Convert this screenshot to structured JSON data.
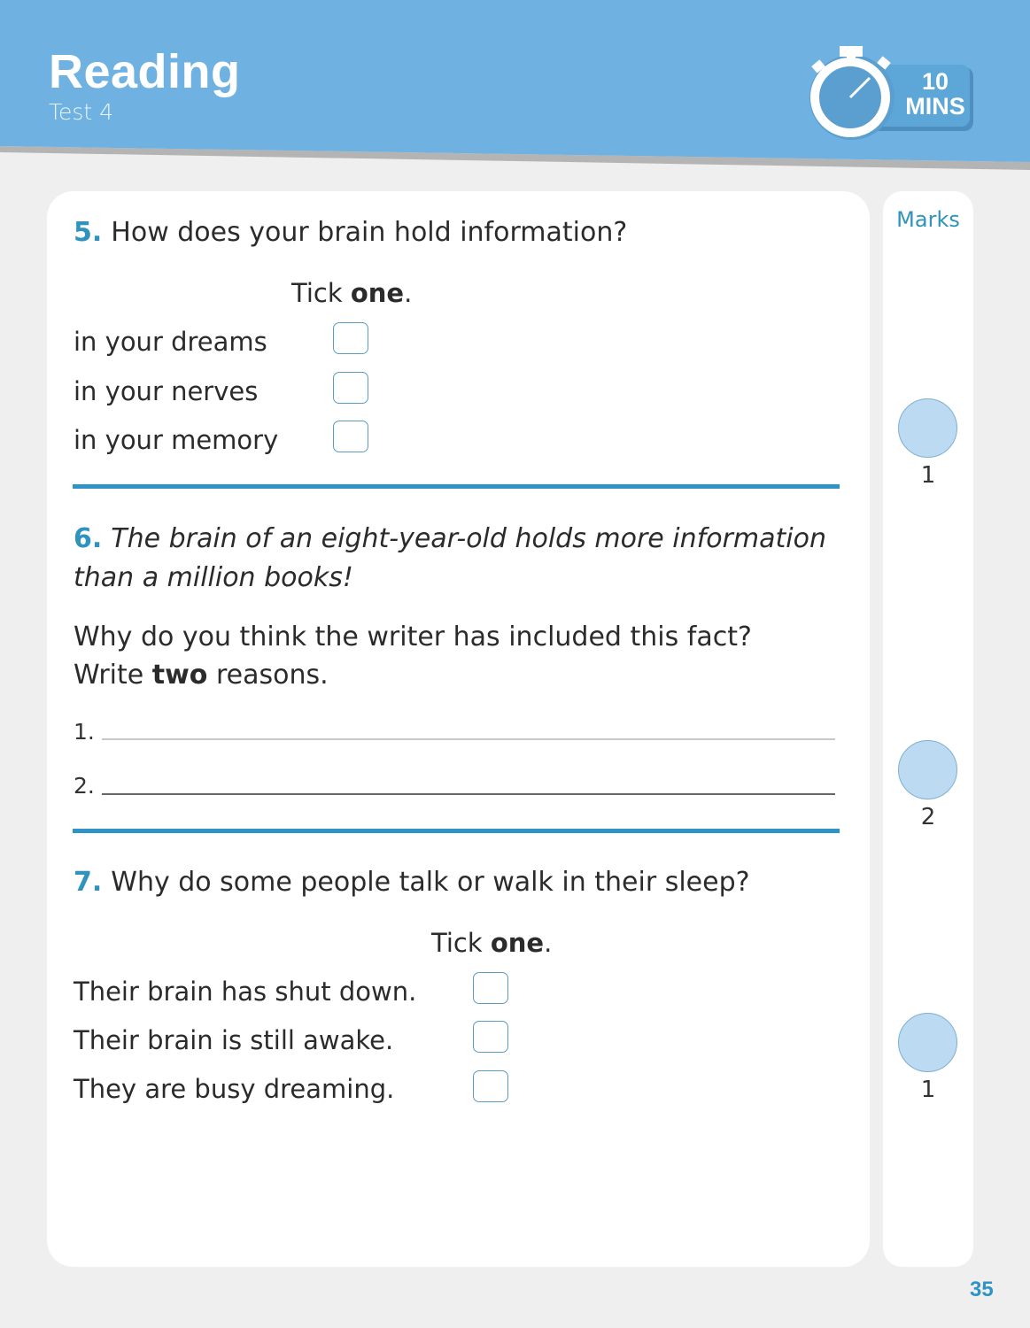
{
  "header": {
    "title": "Reading",
    "subtitle": "Test 4",
    "timer": {
      "icon": "stopwatch-icon",
      "value": "10",
      "unit": "MINS"
    }
  },
  "colors": {
    "header_bg": "#6fb2e1",
    "accent": "#2f93bd",
    "mark_circle": "#bcdaf1"
  },
  "questions": [
    {
      "number": "5.",
      "text": "How does your brain hold information?",
      "instruction_prefix": "Tick ",
      "instruction_bold": "one",
      "instruction_suffix": ".",
      "options": [
        "in your dreams",
        "in your nerves",
        "in your memory"
      ]
    },
    {
      "number": "6.",
      "quote_line1": "The brain of an eight-year-old holds more information",
      "quote_line2": "than a million books!",
      "prompt": "Why do you think the writer has included this fact?",
      "instruction_prefix": "Write ",
      "instruction_bold": "two",
      "instruction_suffix": " reasons.",
      "answer_labels": [
        "1.",
        "2."
      ],
      "answers": [
        "",
        ""
      ]
    },
    {
      "number": "7.",
      "text": "Why do some people talk or walk in their sleep?",
      "instruction_prefix": "Tick ",
      "instruction_bold": "one",
      "instruction_suffix": ".",
      "options": [
        "Their brain has shut down.",
        "Their brain is still awake.",
        "They are busy dreaming."
      ]
    }
  ],
  "marks": {
    "title": "Marks",
    "values": [
      "1",
      "2",
      "1"
    ]
  },
  "page_number": "35"
}
